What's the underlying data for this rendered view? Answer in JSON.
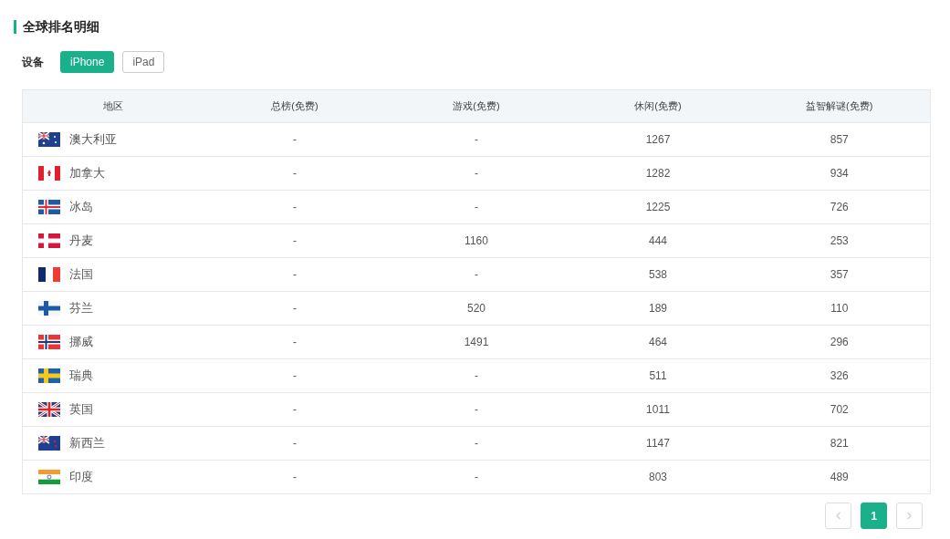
{
  "section_title": "全球排名明细",
  "device_filter": {
    "label": "设备",
    "options": [
      {
        "label": "iPhone",
        "selected": true
      },
      {
        "label": "iPad",
        "selected": false
      }
    ]
  },
  "table": {
    "columns": [
      "地区",
      "总榜(免费)",
      "游戏(免费)",
      "休闲(免费)",
      "益智解谜(免费)"
    ],
    "rows": [
      {
        "cells": [
          "澳大利亚",
          "-",
          "-",
          "1267",
          "857"
        ]
      },
      {
        "cells": [
          "加拿大",
          "-",
          "-",
          "1282",
          "934"
        ]
      },
      {
        "cells": [
          "冰岛",
          "-",
          "-",
          "1225",
          "726"
        ]
      },
      {
        "cells": [
          "丹麦",
          "-",
          "1160",
          "444",
          "253"
        ]
      },
      {
        "cells": [
          "法国",
          "-",
          "-",
          "538",
          "357"
        ]
      },
      {
        "cells": [
          "芬兰",
          "-",
          "520",
          "189",
          "110"
        ]
      },
      {
        "cells": [
          "挪威",
          "-",
          "1491",
          "464",
          "296"
        ]
      },
      {
        "cells": [
          "瑞典",
          "-",
          "-",
          "511",
          "326"
        ]
      },
      {
        "cells": [
          "英国",
          "-",
          "-",
          "1011",
          "702"
        ]
      },
      {
        "cells": [
          "新西兰",
          "-",
          "-",
          "1147",
          "821"
        ]
      },
      {
        "cells": [
          "印度",
          "-",
          "-",
          "803",
          "489"
        ]
      }
    ]
  },
  "pagination": {
    "prev_disabled": true,
    "next_disabled": true,
    "pages": [
      {
        "label": "1",
        "selected": true
      }
    ]
  }
}
